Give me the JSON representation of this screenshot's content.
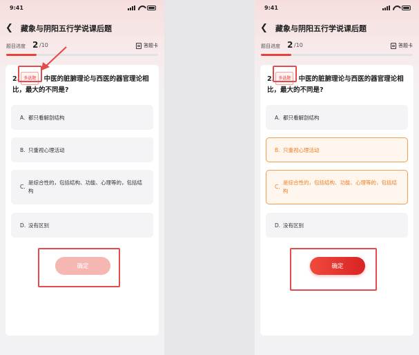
{
  "status": {
    "time": "9:41"
  },
  "title": "藏象与阴阳五行学说课后题",
  "progress": {
    "label": "题目进度",
    "current": "2",
    "total": "/10",
    "fraction": 0.2
  },
  "answer_sheet": "答题卡",
  "question": {
    "number": "2.",
    "tag": "多选题",
    "text": "中医的脏腑理论与西医的器官理论相比，最大的不同是?"
  },
  "options": [
    {
      "key": "A.",
      "text": "都只看解剖结构"
    },
    {
      "key": "B.",
      "text": "只重视心理活动"
    },
    {
      "key": "C.",
      "text": "是综合性的，包括结构、功能、心理等的，包括结构"
    },
    {
      "key": "D.",
      "text": "没有区别"
    }
  ],
  "confirm": "确定",
  "colors": {
    "accent": "#e8413b",
    "selected": "#ef7d27",
    "highlight": "#e34b4b"
  },
  "right_selected": [
    "B",
    "C"
  ]
}
